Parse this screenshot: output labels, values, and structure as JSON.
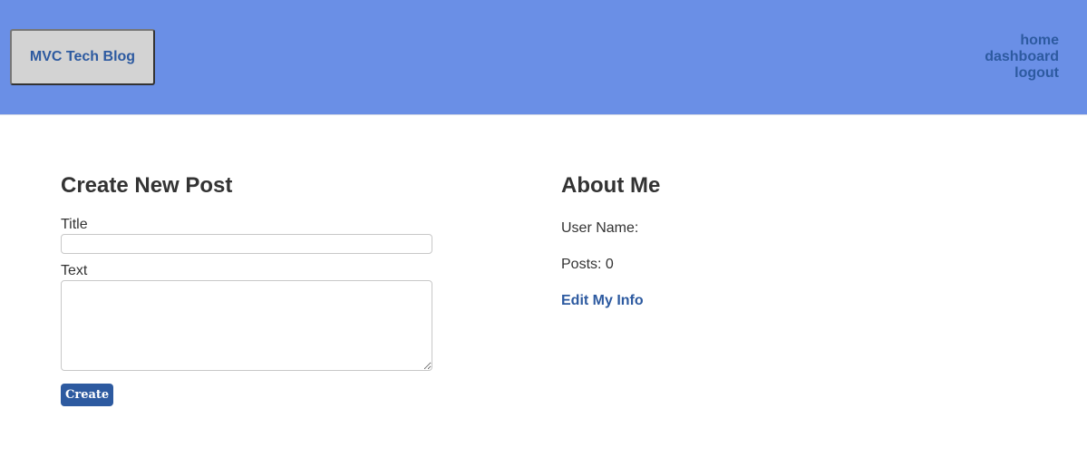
{
  "header": {
    "brand": "MVC Tech Blog",
    "nav": [
      "home",
      "dashboard",
      "logout"
    ],
    "background_color": "#6a8fe6",
    "link_color": "#2d5aa0"
  },
  "create_post": {
    "heading": "Create New Post",
    "title_label": "Title",
    "title_value": "",
    "text_label": "Text",
    "text_value": "",
    "submit_label": "Create",
    "button_color": "#2d5aa0"
  },
  "about": {
    "heading": "About Me",
    "username_label": "User Name:",
    "posts_label": "Posts: 0",
    "edit_link": "Edit My Info"
  }
}
